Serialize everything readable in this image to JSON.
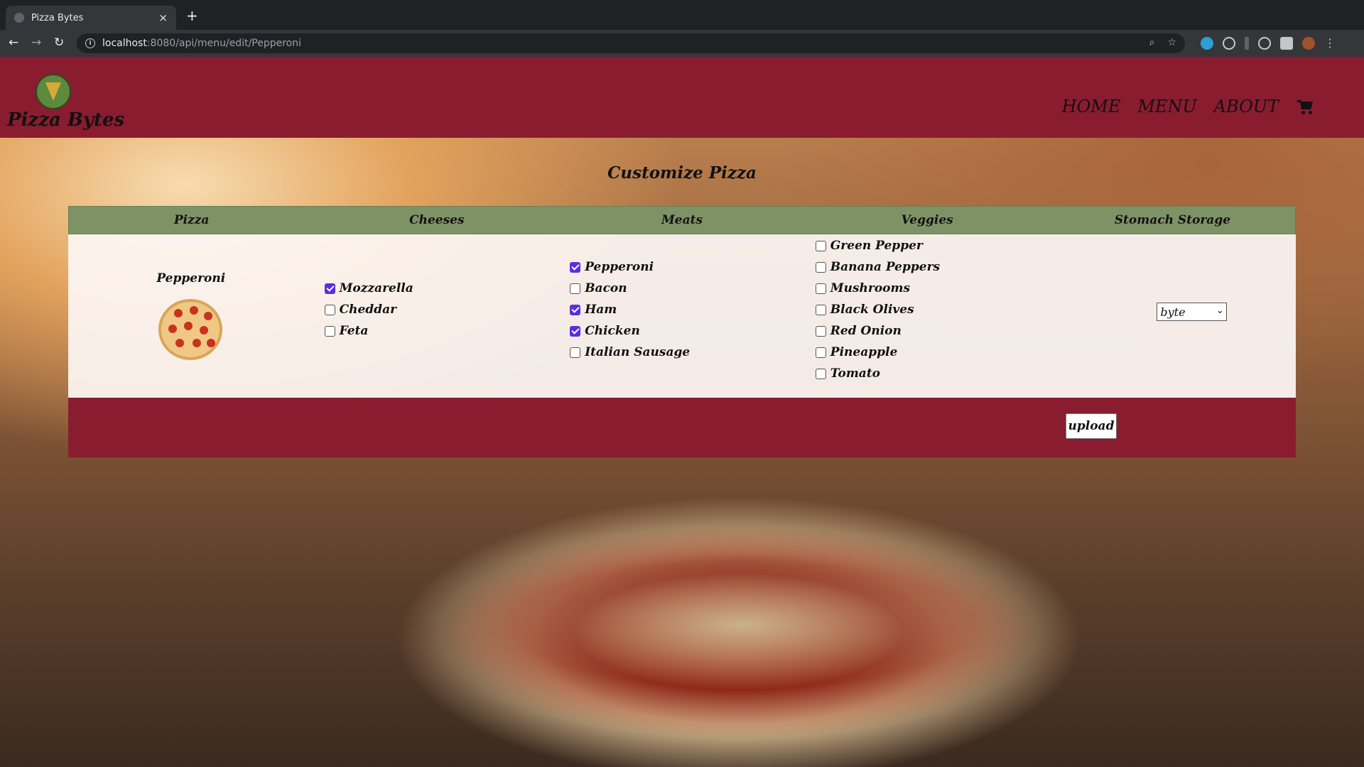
{
  "browser": {
    "tab_title": "Pizza Bytes",
    "close_glyph": "×",
    "new_tab_glyph": "+",
    "url_host": "localhost",
    "url_path": ":8080/api/menu/edit/Pepperoni",
    "back_glyph": "←",
    "forward_glyph": "→",
    "reload_glyph": "↻"
  },
  "header": {
    "brand": "Pizza Bytes",
    "nav": [
      "HOME",
      "MENU",
      "ABOUT"
    ],
    "accent_color": "#8a1c30"
  },
  "page_title": "Customize Pizza",
  "table": {
    "headers": [
      "Pizza",
      "Cheeses",
      "Meats",
      "Veggies",
      "Stomach Storage"
    ],
    "header_color": "#7d9366",
    "pizza": "Pepperoni",
    "cheeses": [
      {
        "label": "Mozzarella",
        "checked": true
      },
      {
        "label": "Cheddar",
        "checked": false
      },
      {
        "label": "Feta",
        "checked": false
      }
    ],
    "meats": [
      {
        "label": "Pepperoni",
        "checked": true
      },
      {
        "label": "Bacon",
        "checked": false
      },
      {
        "label": "Ham",
        "checked": true
      },
      {
        "label": "Chicken",
        "checked": true
      },
      {
        "label": "Italian Sausage",
        "checked": false
      }
    ],
    "veggies": [
      {
        "label": "Green Pepper",
        "checked": false
      },
      {
        "label": "Banana Peppers",
        "checked": false
      },
      {
        "label": "Mushrooms",
        "checked": false
      },
      {
        "label": "Black Olives",
        "checked": false
      },
      {
        "label": "Red Onion",
        "checked": false
      },
      {
        "label": "Pineapple",
        "checked": false
      },
      {
        "label": "Tomato",
        "checked": false
      }
    ],
    "stomach_storage": "byte",
    "upload_label": "upload"
  }
}
